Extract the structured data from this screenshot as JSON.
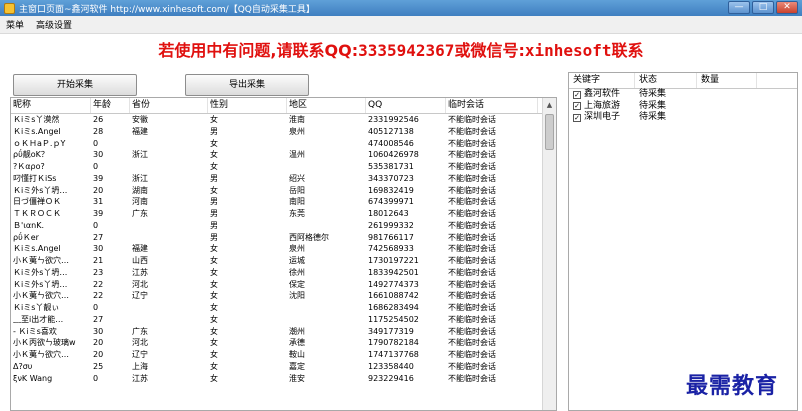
{
  "window": {
    "title": "主窗口页面~鑫河软件 http://www.xinhesoft.com/【QQ自动采集工具】",
    "controls": [
      "—",
      "□",
      "✕"
    ]
  },
  "menu": {
    "items": [
      "菜单",
      "高级设置"
    ]
  },
  "banner": {
    "text_cn": "若使用中有问题,请联系QQ:",
    "qq": "3335942367",
    "mid": "或微信号:",
    "wechat": "xinhesoft",
    "tail": "联系"
  },
  "buttons": {
    "start": "开始采集",
    "export": "导出采集"
  },
  "table": {
    "headers": [
      "昵称",
      "年龄",
      "省份",
      "性别",
      "地区",
      "QQ",
      "临时会话"
    ],
    "rows": [
      [
        "Ｋiミs丫漠然",
        "26",
        "安徽",
        "女",
        "淮南",
        "2331992546",
        "不能临时会话"
      ],
      [
        "Ｋiミs.Angel",
        "28",
        "福建",
        "男",
        "泉州",
        "405127138",
        "不能临时会话"
      ],
      [
        "ｏＫＨaＰ.ｐY",
        "0",
        "",
        "女",
        "",
        "474008546",
        "不能临时会话"
      ],
      [
        "ρΰ靓οΚ？",
        "30",
        "浙江",
        "女",
        "温州",
        "1060426978",
        "不能临时会话"
      ],
      [
        "?Ｋαρο?",
        "0",
        "",
        "女",
        "",
        "535381731",
        "不能临时会话"
      ],
      [
        "叼懂打ＫiSs",
        "39",
        "浙江",
        "男",
        "绍兴",
        "343370723",
        "不能临时会话"
      ],
      [
        "Ｋiミ外s丫坍…",
        "20",
        "湖南",
        "女",
        "岳阳",
        "169832419",
        "不能临时会话"
      ],
      [
        "日づ僵禅ＯＫ",
        "31",
        "河南",
        "男",
        "南阳",
        "674399971",
        "不能临时会话"
      ],
      [
        "ＴＫＲＯＣＫ",
        "39",
        "广东",
        "男",
        "东莞",
        "18012643",
        "不能临时会话"
      ],
      [
        "Ｂ'ιαnΚ.",
        "0",
        "",
        "男",
        "",
        "261999332",
        "不能临时会话"
      ],
      [
        "ρΰＫer",
        "27",
        "",
        "男",
        "西阿格德尔",
        "981766117",
        "不能临时会话"
      ],
      [
        "Ｋiミs.Angel",
        "30",
        "福建",
        "女",
        "泉州",
        "742568933",
        "不能临时会话"
      ],
      [
        "小Ｋ荑ㄣ欲穴…",
        "21",
        "山西",
        "女",
        "运城",
        "1730197221",
        "不能临时会话"
      ],
      [
        "Ｋiミ外s丫坍…",
        "23",
        "江苏",
        "女",
        "徐州",
        "1833942501",
        "不能临时会话"
      ],
      [
        "Ｋiミ外s丫坍…",
        "22",
        "河北",
        "女",
        "保定",
        "1492774373",
        "不能临时会话"
      ],
      [
        "小Ｋ荑ㄣ欲穴…",
        "22",
        "辽宁",
        "女",
        "沈阳",
        "1661088742",
        "不能临时会话"
      ],
      [
        "Ｋiミs丫靓ぃ",
        "0",
        "",
        "女",
        "",
        "1686283494",
        "不能临时会话"
      ],
      [
        "﹏至i出才能…",
        "27",
        "",
        "女",
        "",
        "1175254502",
        "不能临时会话"
      ],
      [
        "- Ｋiミs喜欢",
        "30",
        "广东",
        "女",
        "潮州",
        "349177319",
        "不能临时会话"
      ],
      [
        "小Ｋ丙欲ㄣ玻璃w",
        "20",
        "河北",
        "女",
        "承德",
        "1790782184",
        "不能临时会话"
      ],
      [
        "小Ｋ荑ㄣ欲穴…",
        "20",
        "辽宁",
        "女",
        "鞍山",
        "1747137768",
        "不能临时会话"
      ],
      [
        "Δ?συ",
        "25",
        "上海",
        "女",
        "嘉定",
        "123358440",
        "不能临时会话"
      ],
      [
        "ξνΚ Wang",
        "0",
        "江苏",
        "女",
        "淮安",
        "923229416",
        "不能临时会话"
      ]
    ]
  },
  "keywords": {
    "headers": [
      "关键字",
      "状态",
      "数量"
    ],
    "rows": [
      {
        "keyword": "鑫河软件",
        "status": "待采集",
        "checked": true
      },
      {
        "keyword": "上海旅游",
        "status": "待采集",
        "checked": true
      },
      {
        "keyword": "深圳电子",
        "status": "待采集",
        "checked": true
      }
    ]
  },
  "watermark": "最需教育"
}
